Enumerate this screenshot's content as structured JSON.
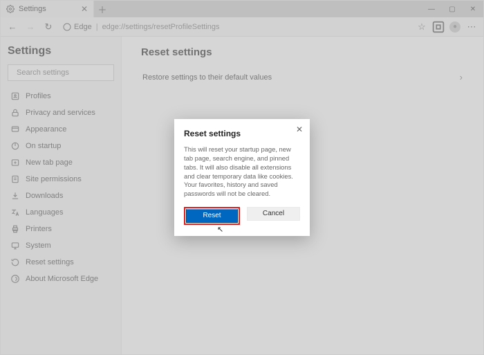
{
  "titlebar": {
    "tab_label": "Settings",
    "win_min": "—",
    "win_max": "▢",
    "win_close": "✕"
  },
  "addrbar": {
    "identity_label": "Edge",
    "url": "edge://settings/resetProfileSettings"
  },
  "sidebar": {
    "title": "Settings",
    "search_placeholder": "Search settings",
    "items": [
      {
        "icon": "profile-icon",
        "label": "Profiles"
      },
      {
        "icon": "lock-icon",
        "label": "Privacy and services"
      },
      {
        "icon": "appearance-icon",
        "label": "Appearance"
      },
      {
        "icon": "power-icon",
        "label": "On startup"
      },
      {
        "icon": "newtab-icon",
        "label": "New tab page"
      },
      {
        "icon": "permissions-icon",
        "label": "Site permissions"
      },
      {
        "icon": "download-icon",
        "label": "Downloads"
      },
      {
        "icon": "language-icon",
        "label": "Languages"
      },
      {
        "icon": "printer-icon",
        "label": "Printers"
      },
      {
        "icon": "system-icon",
        "label": "System"
      },
      {
        "icon": "reset-icon",
        "label": "Reset settings"
      },
      {
        "icon": "about-icon",
        "label": "About Microsoft Edge"
      }
    ]
  },
  "main": {
    "heading": "Reset settings",
    "row_label": "Restore settings to their default values"
  },
  "dialog": {
    "title": "Reset settings",
    "body": "This will reset your startup page, new tab page, search engine, and pinned tabs. It will also disable all extensions and clear temporary data like cookies. Your favorites, history and saved passwords will not be cleared.",
    "reset_label": "Reset",
    "cancel_label": "Cancel"
  }
}
